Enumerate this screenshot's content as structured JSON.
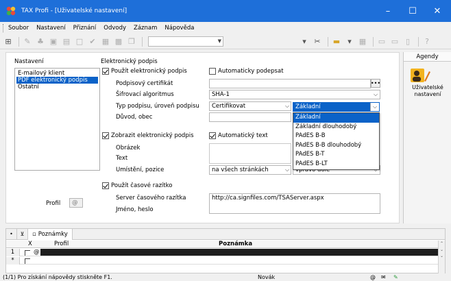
{
  "window": {
    "title": "TAX Profi - [Uživatelské nastavení]",
    "controls": [
      "–",
      "☐",
      "✕"
    ],
    "accent": "#1e6fd9"
  },
  "menu": [
    "Soubor",
    "Nastavení",
    "Přiznání",
    "Odvody",
    "Záznam",
    "Nápověda"
  ],
  "nav": {
    "title": "Nastavení",
    "items": [
      "E-mailový klient",
      "PDF elektronický podpis",
      "Ostatní"
    ],
    "selected_index": 1,
    "profil_label": "Profil",
    "profil_value": "@"
  },
  "signature": {
    "section_title": "Elektronický podpis",
    "use_checkbox": "Použít elektronický podpis",
    "use_checked": true,
    "auto_sign_checkbox": "Automaticky podepsat",
    "auto_sign_checked": false,
    "cert_label": "Podpisový certifikát",
    "cert_value": "",
    "algo_label": "Šifrovací algoritmus",
    "algo_value": "SHA-1",
    "type_label": "Typ podpisu, úroveň podpisu",
    "type_value": "Certifikovat",
    "level_value": "Základní",
    "reason_label": "Důvod, obec",
    "reason_value": "",
    "level_options": [
      "Základní",
      "Základní dlouhodobý",
      "PAdES B-B",
      "PAdES B-B dlouhodobý",
      "PAdES B-T",
      "PAdES B-LT"
    ],
    "level_selected_index": 0
  },
  "display": {
    "show_checkbox": "Zobrazit elektronický podpis",
    "show_checked": true,
    "auto_text_checkbox": "Automatický text",
    "auto_text_checked": true,
    "image_label": "Obrázek",
    "text_label": "Text",
    "position_label": "Umístění, pozice",
    "position_value": "na všech stránkách",
    "position_value2": "vpravo dole"
  },
  "timestamp": {
    "use_checkbox": "Použít časové razítko",
    "use_checked": true,
    "server_label": "Server časového razítka",
    "server_value": "http://ca.signfiles.com/TSAServer.aspx",
    "login_label": "Jméno, heslo"
  },
  "agendy": {
    "title": "Agendy",
    "tile_label": "Uživatelské nastavení"
  },
  "bottom": {
    "tab_label": "Poznámky",
    "col_x": "X",
    "col_profil": "Profil",
    "col_note": "Poznámka",
    "rows": [
      {
        "num": "1",
        "profil": "@"
      },
      {
        "num": "*",
        "profil": ""
      }
    ]
  },
  "status": {
    "hint": "(1/1) Pro získání nápovědy stiskněte F1.",
    "user": "Novák",
    "flag": "@"
  }
}
